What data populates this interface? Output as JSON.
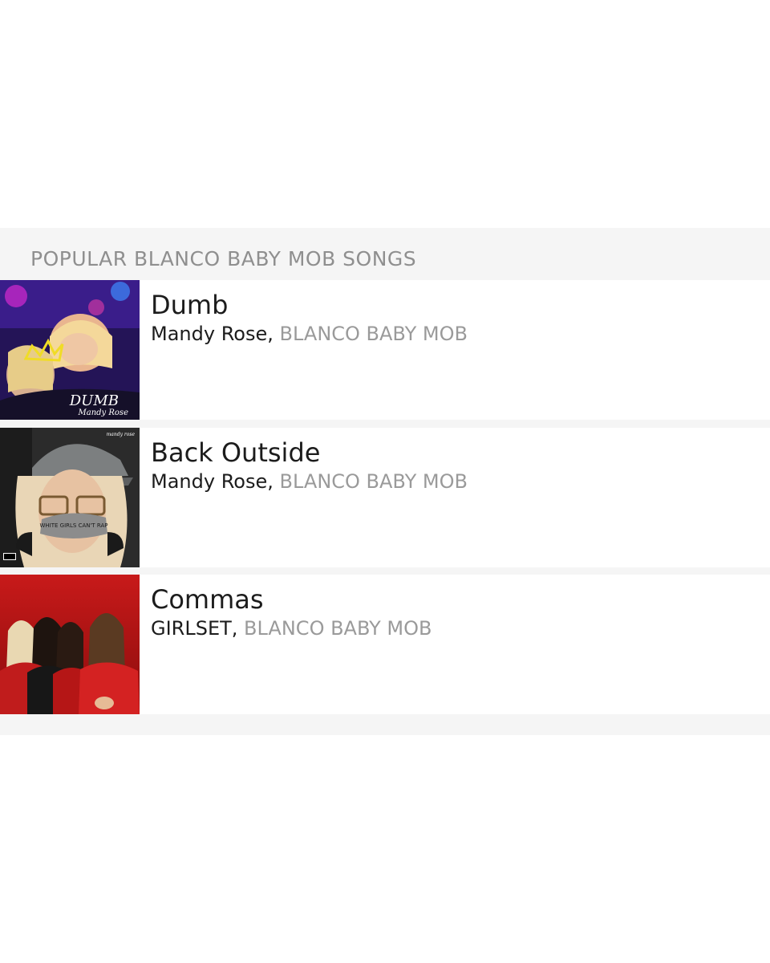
{
  "section": {
    "title": "POPULAR BLANCO BABY MOB SONGS"
  },
  "songs": [
    {
      "title": "Dumb",
      "artist": "Mandy Rose",
      "separator": ", ",
      "featured": "BLANCO BABY MOB",
      "cover_text": "DUMB",
      "cover_subtext": "Mandy Rose",
      "cover_colors": [
        "#2a1a6e",
        "#c21fb8",
        "#3d8cff"
      ]
    },
    {
      "title": "Back Outside",
      "artist": "Mandy Rose",
      "separator": ", ",
      "featured": "BLANCO BABY MOB",
      "cover_text": "WHITE GIRLS CAN'T RAP",
      "cover_subtext": "mandy rose",
      "cover_colors": [
        "#2b2b2b",
        "#8a8a8a",
        "#e8d2b8"
      ]
    },
    {
      "title": "Commas",
      "artist": "GIRLSET",
      "separator": ", ",
      "featured": "BLANCO BABY MOB",
      "cover_colors": [
        "#c41818",
        "#7a0b0b",
        "#f0c2a0"
      ]
    }
  ]
}
